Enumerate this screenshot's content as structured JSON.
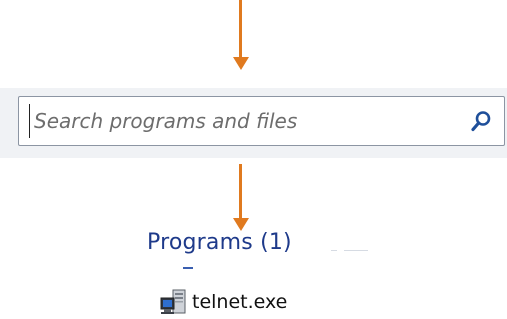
{
  "search": {
    "placeholder": "Search programs and files",
    "value": ""
  },
  "results": {
    "programs_heading": "Programs (1)",
    "items": [
      {
        "label": "telnet.exe",
        "icon": "telnet-program-icon"
      }
    ]
  },
  "annotations": {
    "arrow_color": "#e07a1f"
  },
  "colors": {
    "heading": "#1e3a8a",
    "search_strip": "#f0f2f5",
    "search_border": "#8c95a3"
  }
}
